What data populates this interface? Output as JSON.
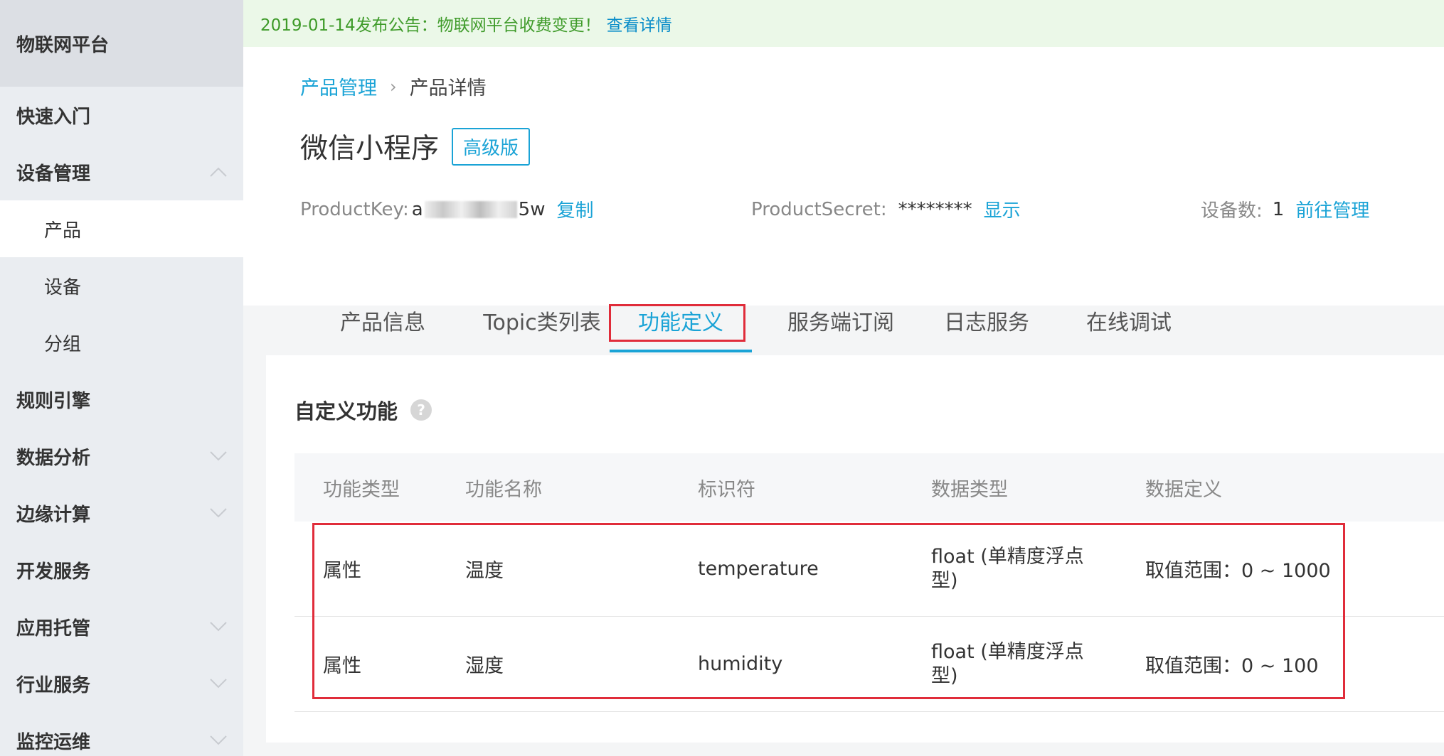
{
  "sidebar": {
    "brand": "物联网平台",
    "items": [
      {
        "label": "快速入门"
      },
      {
        "label": "设备管理"
      },
      {
        "label": "产品"
      },
      {
        "label": "设备"
      },
      {
        "label": "分组"
      },
      {
        "label": "规则引擎"
      },
      {
        "label": "数据分析"
      },
      {
        "label": "边缘计算"
      },
      {
        "label": "开发服务"
      },
      {
        "label": "应用托管"
      },
      {
        "label": "行业服务"
      },
      {
        "label": "监控运维"
      }
    ]
  },
  "notice": {
    "text": "2019-01-14发布公告：物联网平台收费变更！",
    "link": "查看详情"
  },
  "breadcrumb": {
    "parent": "产品管理",
    "separator": "›",
    "current": "产品详情"
  },
  "product": {
    "title": "微信小程序",
    "edition": "高级版",
    "key_label": "ProductKey:",
    "key_prefix": "a",
    "key_suffix": "5w",
    "copy_label": "复制",
    "secret_label": "ProductSecret:",
    "secret_value": "********",
    "show_label": "显示",
    "device_count_label": "设备数:",
    "device_count": "1",
    "manage_label": "前往管理"
  },
  "tabs": [
    {
      "label": "产品信息"
    },
    {
      "label": "Topic类列表"
    },
    {
      "label": "功能定义"
    },
    {
      "label": "服务端订阅"
    },
    {
      "label": "日志服务"
    },
    {
      "label": "在线调试"
    }
  ],
  "section": {
    "title": "自定义功能",
    "help": "?"
  },
  "table": {
    "headers": [
      "功能类型",
      "功能名称",
      "标识符",
      "数据类型",
      "数据定义"
    ],
    "rows": [
      [
        "属性",
        "温度",
        "temperature",
        "float (单精度浮点型)",
        "取值范围：0 ~ 1000"
      ],
      [
        "属性",
        "湿度",
        "humidity",
        "float (单精度浮点型)",
        "取值范围：0 ~ 100"
      ]
    ]
  },
  "colors": {
    "accent": "#1aa3d6",
    "highlight": "#e02c3a",
    "notice_bg": "#ebf8e8",
    "notice_text": "#3f9b2a"
  }
}
